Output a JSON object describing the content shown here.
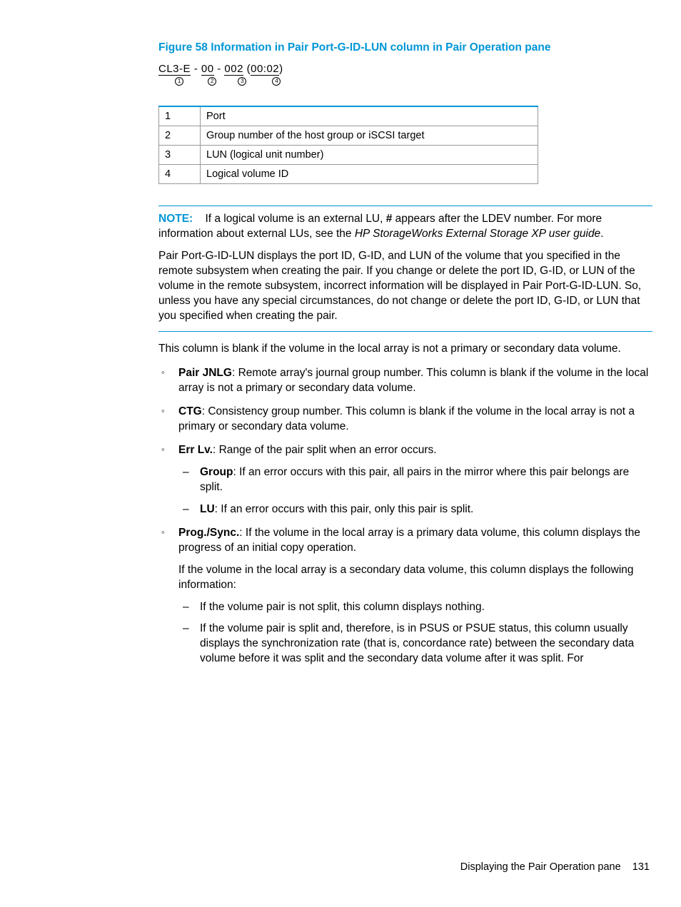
{
  "figure": {
    "title": "Figure 58 Information in Pair Port-G-ID-LUN column in Pair Operation pane",
    "seg1": "CL3-E",
    "dash": " - ",
    "seg2": "00",
    "seg3": "002",
    "seg4_open": " (",
    "seg4": "00:02",
    "seg4_close": ")",
    "c1": "1",
    "c2": "2",
    "c3": "3",
    "c4": "4"
  },
  "table": {
    "rows": [
      {
        "num": "1",
        "desc": "Port"
      },
      {
        "num": "2",
        "desc": "Group number of the host group or iSCSI target"
      },
      {
        "num": "3",
        "desc": "LUN (logical unit number)"
      },
      {
        "num": "4",
        "desc": "Logical volume ID"
      }
    ]
  },
  "note": {
    "label": "NOTE:",
    "text_a": "If a logical volume is an external LU, ",
    "hash": "#",
    "text_b": " appears after the LDEV number. For more information about external LUs, see the ",
    "italic": "HP StorageWorks External Storage XP user guide",
    "period": "."
  },
  "warn_para": "Pair Port-G-ID-LUN displays the port ID, G-ID, and LUN of the volume that you specified in the remote subsystem when creating the pair. If you change or delete the port ID, G-ID, or LUN of the volume in the remote subsystem, incorrect information will be displayed in Pair Port-G-ID-LUN. So, unless you have any special circumstances, do not change or delete the port ID, G-ID, or LUN that you specified when creating the pair.",
  "blank_para": "This column is blank if the volume in the local array is not a primary or secondary data volume.",
  "items": {
    "jnlg_label": "Pair JNLG",
    "jnlg_text": ": Remote array's journal group number. This column is blank if the volume in the local array is not a primary or secondary data volume.",
    "ctg_label": "CTG",
    "ctg_text": ": Consistency group number. This column is blank if the volume in the local array is not a primary or secondary data volume.",
    "err_label": "Err Lv.",
    "err_text": ": Range of the pair split when an error occurs.",
    "err_sub": {
      "group_label": "Group",
      "group_text": ": If an error occurs with this pair, all pairs in the mirror where this pair belongs are split.",
      "lu_label": "LU",
      "lu_text": ": If an error occurs with this pair, only this pair is split."
    },
    "prog_label": "Prog./Sync.",
    "prog_text": ": If the volume in the local array is a primary data volume, this column displays the progress of an initial copy operation.",
    "prog_para2": "If the volume in the local array is a secondary data volume, this column displays the following information:",
    "prog_sub": {
      "s1": "If the volume pair is not split, this column displays nothing.",
      "s2": "If the volume pair is split and, therefore, is in PSUS or PSUE status, this column usually displays the synchronization rate (that is, concordance rate) between the secondary data volume before it was split and the secondary data volume after it was split. For"
    }
  },
  "footer": {
    "text": "Displaying the Pair Operation pane",
    "page": "131"
  }
}
